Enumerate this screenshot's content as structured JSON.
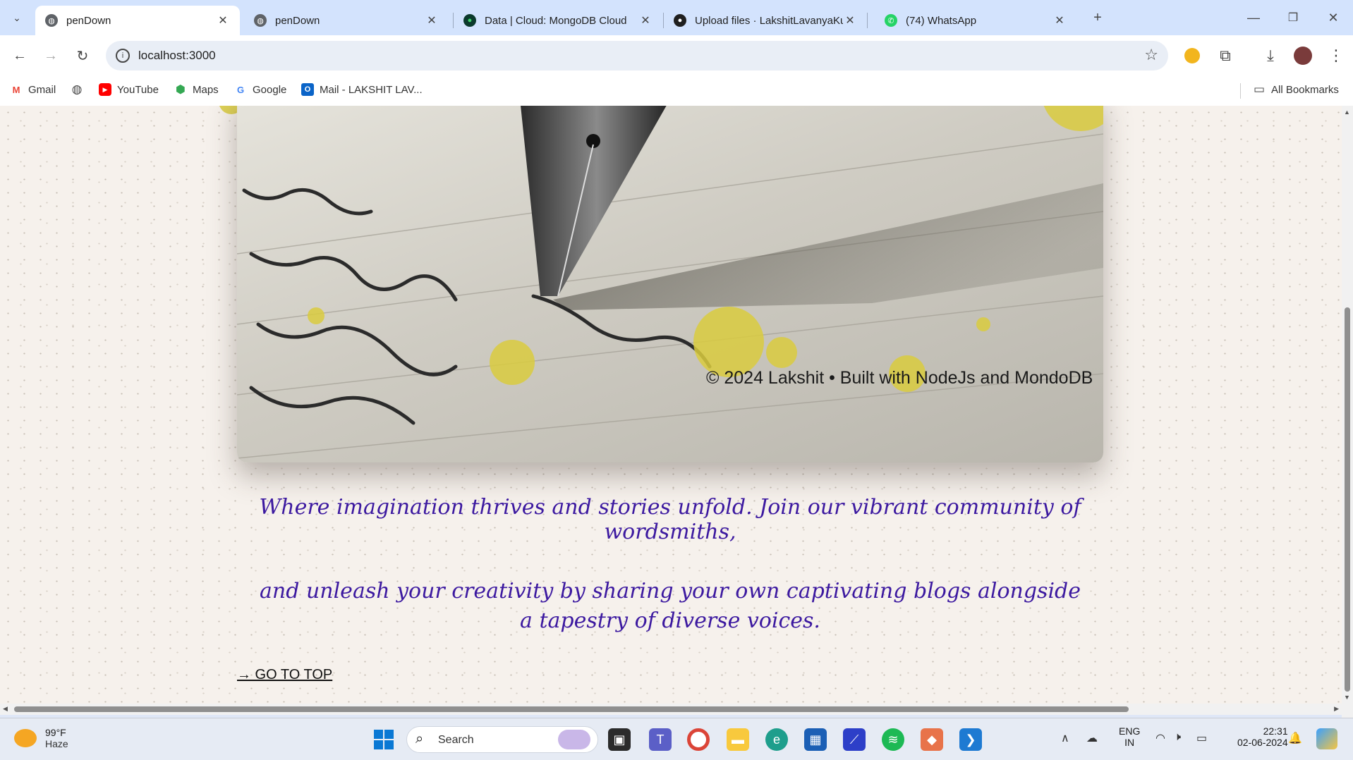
{
  "browser": {
    "tabs": [
      {
        "title": "penDown",
        "active": true,
        "icon": "globe-icon"
      },
      {
        "title": "penDown",
        "active": false,
        "icon": "globe-icon"
      },
      {
        "title": "Data | Cloud: MongoDB Cloud",
        "active": false,
        "icon": "mongodb-leaf-icon"
      },
      {
        "title": "Upload files · LakshitLavanyaKu",
        "active": false,
        "icon": "github-icon"
      },
      {
        "title": "(74) WhatsApp",
        "active": false,
        "icon": "whatsapp-icon"
      }
    ],
    "new_tab_symbol": "+",
    "address": "localhost:3000",
    "bookmarks": [
      {
        "label": "Gmail",
        "icon": "gmail-icon"
      },
      {
        "label": "",
        "icon": "globe-icon"
      },
      {
        "label": "YouTube",
        "icon": "youtube-icon"
      },
      {
        "label": "Maps",
        "icon": "maps-icon"
      },
      {
        "label": "Google",
        "icon": "google-icon"
      },
      {
        "label": "Mail - LAKSHIT LAV...",
        "icon": "outlook-icon"
      }
    ],
    "all_bookmarks": "All Bookmarks"
  },
  "page": {
    "footer_credit": "© 2024 Lakshit • Built with NodeJs and MondoDB",
    "tagline_line1": "Where imagination thrives and stories unfold. Join our vibrant community of wordsmiths,",
    "tagline_line2": "and unleash your creativity by sharing your own captivating blogs alongside a tapestry of diverse voices.",
    "go_to_top": "→ GO TO TOP",
    "accent_color": "#3c19a0",
    "dot_color": "#d9cb3e"
  },
  "taskbar": {
    "weather_temp": "99°F",
    "weather_desc": "Haze",
    "search_placeholder": "Search",
    "lang_top": "ENG",
    "lang_bottom": "IN",
    "time": "22:31",
    "date": "02-06-2024"
  }
}
